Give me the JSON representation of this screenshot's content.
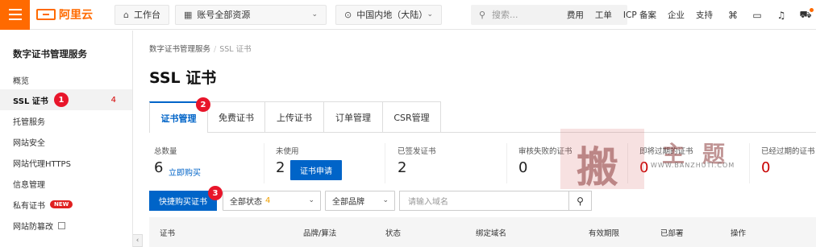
{
  "topbar": {
    "logo_text": "阿里云",
    "workbench": "工作台",
    "account_scope": "账号全部资源",
    "region": "中国内地（大陆）",
    "search_placeholder": "搜索...",
    "links": [
      "费用",
      "工单",
      "ICP 备案",
      "企业",
      "支持"
    ],
    "icons": [
      "code-icon",
      "terminal-icon",
      "bell-icon",
      "cart-icon"
    ],
    "accent_color": "#ff6a00"
  },
  "sidebar": {
    "title": "数字证书管理服务",
    "items": [
      {
        "label": "概览"
      },
      {
        "label": "SSL 证书",
        "count": "4"
      },
      {
        "label": "托管服务"
      },
      {
        "label": "网站安全"
      },
      {
        "label": "网站代理HTTPS"
      },
      {
        "label": "信息管理"
      },
      {
        "label": "私有证书",
        "badge": "NEW"
      },
      {
        "label": "网站防篡改"
      }
    ]
  },
  "markers": [
    "1",
    "2",
    "3"
  ],
  "breadcrumb": {
    "root": "数字证书管理服务",
    "sep": "/",
    "current": "SSL 证书"
  },
  "page_title": "SSL 证书",
  "tabs": [
    "证书管理",
    "免费证书",
    "上传证书",
    "订单管理",
    "CSR管理"
  ],
  "stats": [
    {
      "label": "总数量",
      "value": "6",
      "link": "立即购买"
    },
    {
      "label": "未使用",
      "value": "2",
      "button": "证书申请"
    },
    {
      "label": "已签发证书",
      "value": "2"
    },
    {
      "label": "审核失败的证书",
      "value": "0"
    },
    {
      "label": "即将过期的证书",
      "value": "0"
    },
    {
      "label": "已经过期的证书",
      "value": "0"
    }
  ],
  "toolbar": {
    "quick_buy": "快捷购买证书",
    "status_filter": "全部状态",
    "status_count": "4",
    "brand_filter": "全部品牌",
    "domain_placeholder": "请输入域名"
  },
  "table": {
    "headers": [
      "证书",
      "品牌/算法",
      "状态",
      "绑定域名",
      "有效期限",
      "已部署",
      "操作"
    ]
  },
  "watermark": {
    "chars": [
      "搬",
      "主",
      "题"
    ],
    "url": "WWW.BANZHUTI.COM"
  }
}
